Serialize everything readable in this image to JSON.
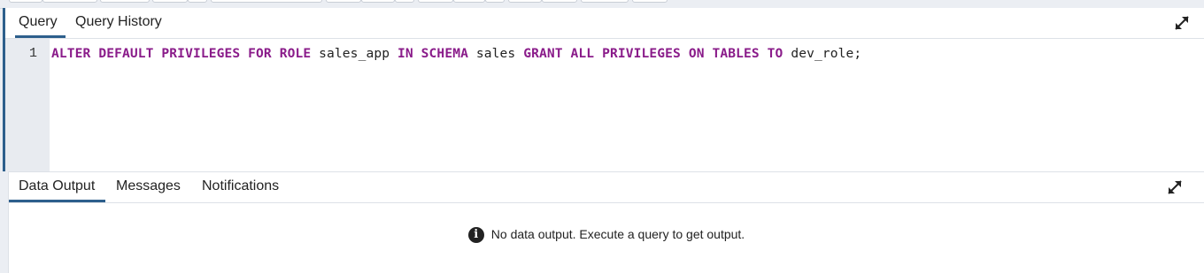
{
  "query_tabs": [
    {
      "label": "Query",
      "active": true
    },
    {
      "label": "Query History",
      "active": false
    }
  ],
  "editor": {
    "line_number": "1",
    "tokens": [
      {
        "text": "ALTER DEFAULT PRIVILEGES FOR ROLE",
        "kind": "keyword"
      },
      {
        "text": " sales_app ",
        "kind": "identifier"
      },
      {
        "text": "IN SCHEMA",
        "kind": "keyword"
      },
      {
        "text": " sales ",
        "kind": "identifier"
      },
      {
        "text": "GRANT ALL PRIVILEGES ON TABLES TO",
        "kind": "keyword"
      },
      {
        "text": " dev_role;",
        "kind": "identifier"
      }
    ]
  },
  "output_tabs": [
    {
      "label": "Data Output",
      "active": true
    },
    {
      "label": "Messages",
      "active": false
    },
    {
      "label": "Notifications",
      "active": false
    }
  ],
  "output": {
    "empty_message": "No data output. Execute a query to get output.",
    "icon": "info-icon"
  },
  "icons": {
    "expand": "expand-icon"
  },
  "colors": {
    "accent": "#2d5f8c",
    "keyword": "#8a1c8a"
  }
}
